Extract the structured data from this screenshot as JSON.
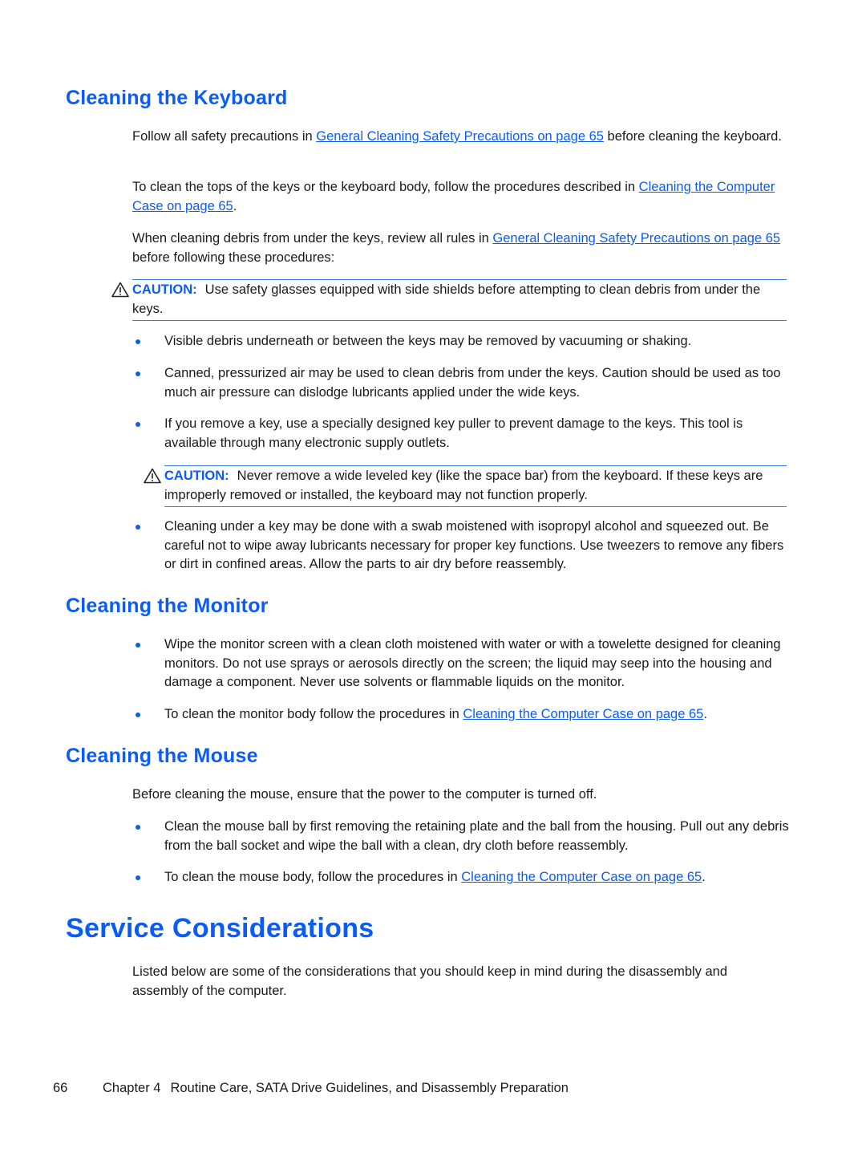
{
  "sections": {
    "keyboard": {
      "heading": "Cleaning the Keyboard",
      "p1": {
        "before": "Follow all safety precautions in ",
        "link": "General Cleaning Safety Precautions on page 65",
        "after": " before cleaning the keyboard."
      },
      "p2": {
        "before": "To clean the tops of the keys or the keyboard body, follow the procedures described in ",
        "link": "Cleaning the Computer Case on page 65",
        "after": "."
      },
      "p3": {
        "before": "When cleaning debris from under the keys, review all rules in ",
        "link": "General Cleaning Safety Precautions on page 65",
        "after": " before following these procedures:"
      },
      "caution1": {
        "label": "CAUTION:",
        "text": "Use safety glasses equipped with side shields before attempting to clean debris from under the keys."
      },
      "bullets": [
        "Visible debris underneath or between the keys may be removed by vacuuming or shaking.",
        "Canned, pressurized air may be used to clean debris from under the keys. Caution should be used as too much air pressure can dislodge lubricants applied under the wide keys.",
        "If you remove a key, use a specially designed key puller to prevent damage to the keys. This tool is available through many electronic supply outlets.",
        "Cleaning under a key may be done with a swab moistened with isopropyl alcohol and squeezed out. Be careful not to wipe away lubricants necessary for proper key functions. Use tweezers to remove any fibers or dirt in confined areas. Allow the parts to air dry before reassembly."
      ],
      "caution2": {
        "label": "CAUTION:",
        "text": "Never remove a wide leveled key (like the space bar) from the keyboard. If these keys are improperly removed or installed, the keyboard may not function properly."
      }
    },
    "monitor": {
      "heading": "Cleaning the Monitor",
      "bullet1": "Wipe the monitor screen with a clean cloth moistened with water or with a towelette designed for cleaning monitors. Do not use sprays or aerosols directly on the screen; the liquid may seep into the housing and damage a component. Never use solvents or flammable liquids on the monitor.",
      "bullet2": {
        "before": "To clean the monitor body follow the procedures in ",
        "link": "Cleaning the Computer Case on page 65",
        "after": "."
      }
    },
    "mouse": {
      "heading": "Cleaning the Mouse",
      "intro": "Before cleaning the mouse, ensure that the power to the computer is turned off.",
      "bullet1": "Clean the mouse ball by first removing the retaining plate and the ball from the housing. Pull out any debris from the ball socket and wipe the ball with a clean, dry cloth before reassembly.",
      "bullet2": {
        "before": "To clean the mouse body, follow the procedures in ",
        "link": "Cleaning the Computer Case on page 65",
        "after": "."
      }
    },
    "service": {
      "heading": "Service Considerations",
      "intro": "Listed below are some of the considerations that you should keep in mind during the disassembly and assembly of the computer."
    }
  },
  "footer": {
    "page_number": "66",
    "chapter": "Chapter 4",
    "title": "Routine Care, SATA Drive Guidelines, and Disassembly Preparation"
  },
  "colors": {
    "heading": "#0a5cf5",
    "link": "#0a5cf5",
    "rule": "#2f7de8"
  }
}
